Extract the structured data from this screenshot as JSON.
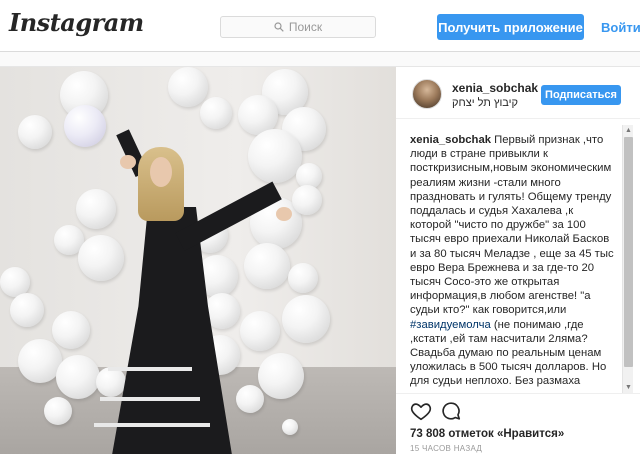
{
  "header": {
    "logo": "Instagram",
    "search_placeholder": "Поиск",
    "get_app_label": "Получить приложение",
    "login_label": "Войти"
  },
  "post": {
    "username": "xenia_sobchak",
    "location": "קיבוץ תל יצחק",
    "follow_label": "Подписаться",
    "caption": {
      "username": "xenia_sobchak",
      "text_before_tag": "Первый признак ,что люди в стране привыкли к посткризисным,новым экономическим реалиям жизни -стали много праздновать и гулять! Общему тренду поддалась и судья Хахалева ,к которой \"чисто по дружбе\" за 100 тысяч евро приехали Николай Басков и за 80 тысяч Меладзе , еще за 45 тыс евро Вера Брежнева и за где-то 20 тысяч Сосо-это же открытая информация,в любом агенстве! \"а судьи кто?\" как говорится,или",
      "hashtag": "#завидуемолча",
      "text_after_tag": "(не понимаю ,где ,кстати ,ей там насчитали 2ляма? Свадьба думаю по реальным ценам уложилась в 500 тысяч долларов. Но для судьи неплохо. Без размаха какого-нибудь Захарченко конечно,так \"скромно посидели\"...🙈🙈🙈 Но вот врать про \"приехали по дружбе\" зачем?"
    },
    "likes_count": "73 808",
    "likes_label": "отметок «Нравится»",
    "time_ago": "15 часов назад"
  },
  "icons": {
    "search": "search-icon",
    "like": "heart-icon",
    "comment": "comment-icon"
  },
  "colors": {
    "accent": "#3897f0",
    "text": "#262626",
    "muted": "#999999",
    "hashtag": "#003569"
  }
}
